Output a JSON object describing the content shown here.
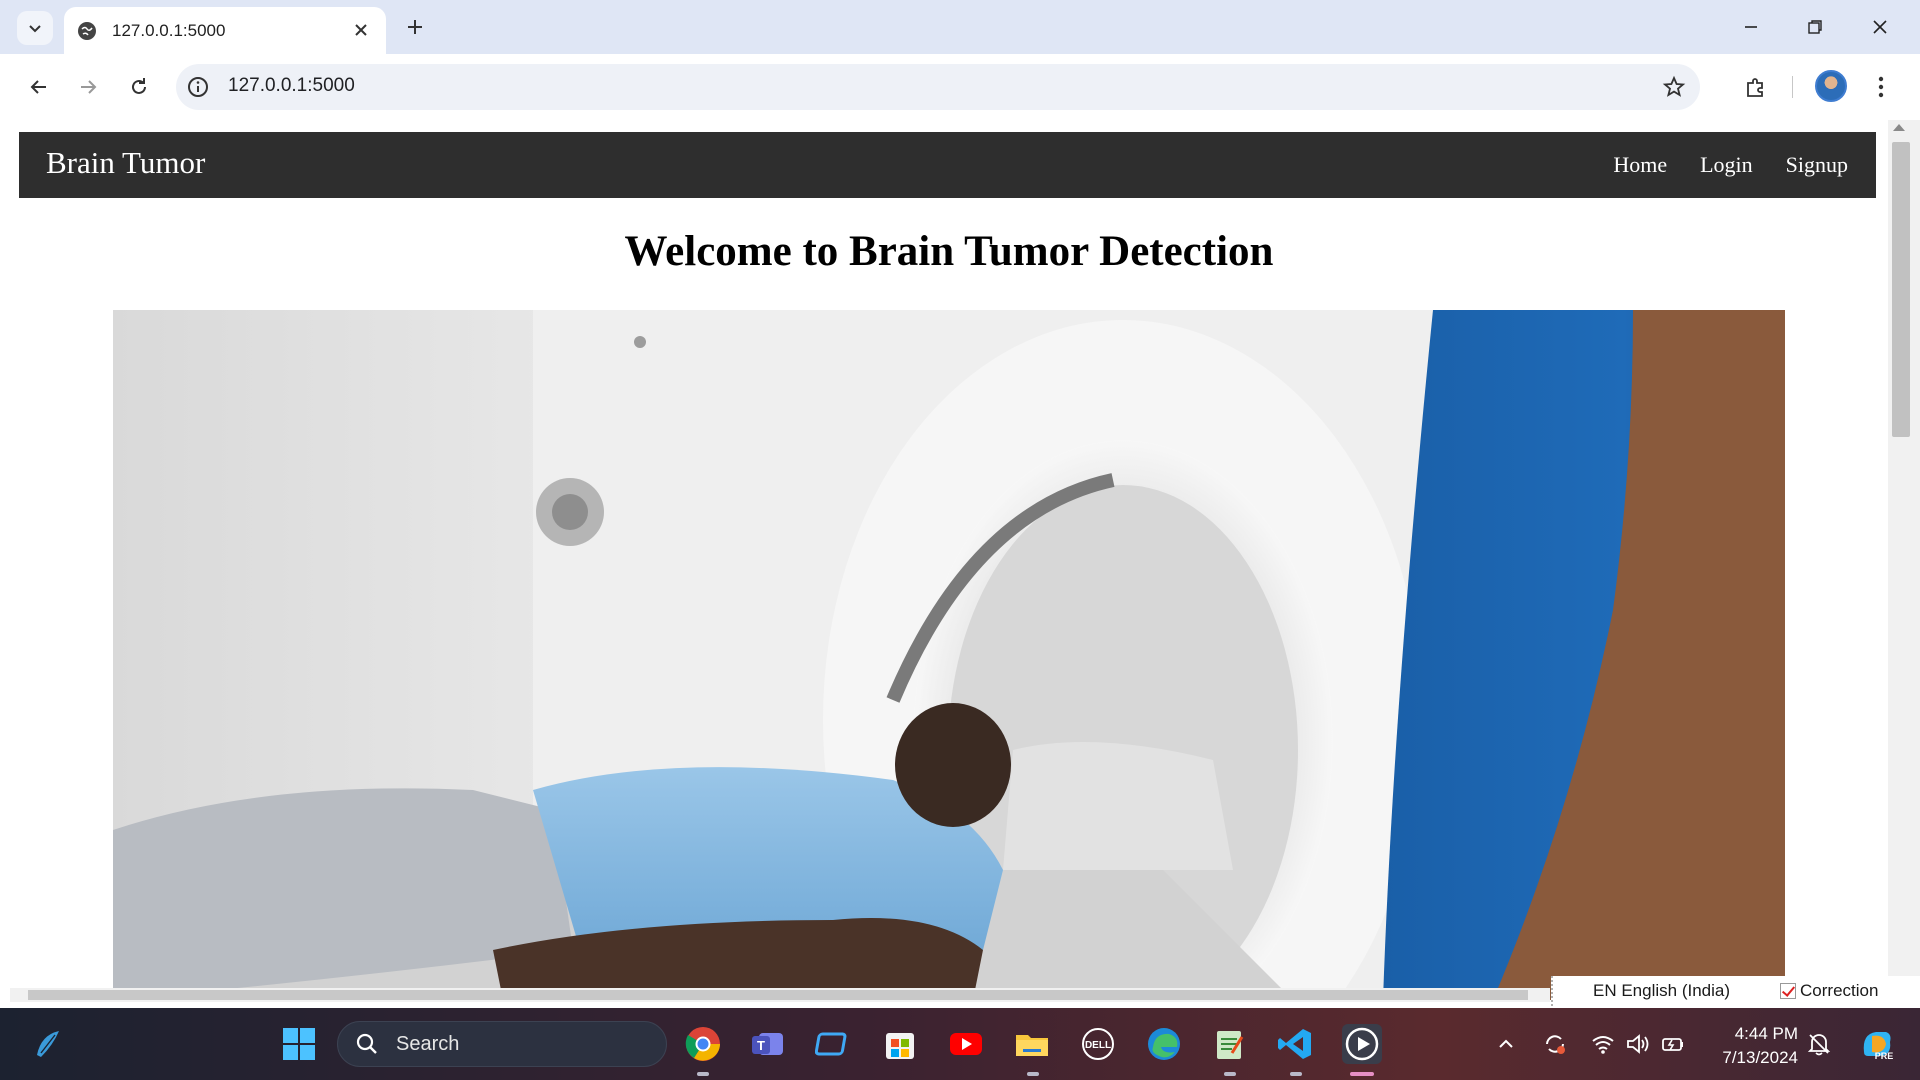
{
  "browser": {
    "tab_title": "127.0.0.1:5000",
    "url": "127.0.0.1:5000"
  },
  "page": {
    "brand": "Brain Tumor",
    "nav_links": [
      "Home",
      "Login",
      "Signup"
    ],
    "title": "Welcome to Brain Tumor Detection"
  },
  "language_bar": {
    "language": "EN English (India)",
    "correction": "Correction"
  },
  "taskbar": {
    "search_label": "Search",
    "time": "4:44 PM",
    "date": "7/13/2024",
    "apps": [
      "chrome-icon",
      "teams-icon",
      "app-icon",
      "store-icon",
      "youtube-icon",
      "file-explorer-icon",
      "dell-icon",
      "edge-icon",
      "notepad-icon",
      "vscode-icon",
      "media-player-icon"
    ]
  },
  "colors": {
    "navbar": "#2e2e2e",
    "tabstrip": "#dfe6f5",
    "scrub_blue": "#1f6bb8"
  }
}
